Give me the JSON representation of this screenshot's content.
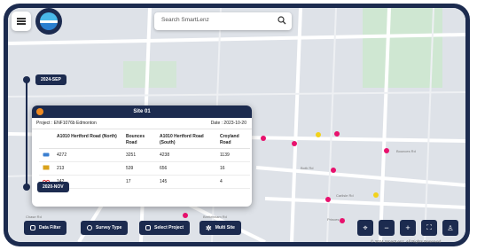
{
  "search": {
    "placeholder": "Search SmartLenz"
  },
  "timeline": {
    "top_label": "2024-SEP",
    "bottom_label": "2020-NOV"
  },
  "popup": {
    "title": "Site 01",
    "project": "Project : ENF1076b Edmonton",
    "date": "Date : 2023-10-20",
    "columns": [
      "A1010 Hertford Road (North)",
      "Bounces Road",
      "A1010 Hertford Road (South)",
      "Croyland Road"
    ],
    "rows": [
      {
        "vehicle": "car-icon",
        "values": [
          "4272",
          "3251",
          "4238",
          "1139"
        ]
      },
      {
        "vehicle": "truck-icon",
        "values": [
          "213",
          "539",
          "656",
          "16"
        ]
      },
      {
        "vehicle": "bike-icon",
        "values": [
          "142",
          "17",
          "145",
          "4"
        ]
      }
    ]
  },
  "toolbar": {
    "data_filter": "Data Filter",
    "survey_type": "Survey Type",
    "select_project": "Select Project",
    "multi_site": "Multi Site"
  },
  "map_labels": {
    "bounces_rd": "Bounces Rd",
    "both_rd": "Both Rd",
    "carlisle": "Carlisle Rd",
    "chase": "Chase Rd",
    "brettenham": "Brettenham Rd",
    "princes": "Princes Rd",
    "morsons": "Morsons Rd",
    "grosvenor": "Grosvenor Rd",
    "picture": "Picture Rd"
  },
  "copyright": "© 2024 SmartLenz, All Rights Reserved",
  "colors": {
    "navy": "#1c2b4f",
    "marker_pink": "#e8116d",
    "marker_yellow": "#f2d21b",
    "marker_green": "#25a244"
  }
}
